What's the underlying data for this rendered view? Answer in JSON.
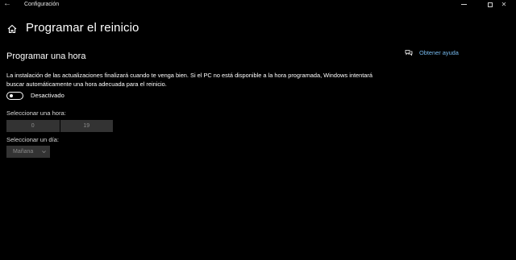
{
  "window": {
    "title": "Configuración",
    "back_glyph": "←",
    "close_glyph": "✕"
  },
  "page": {
    "title": "Programar el reinicio",
    "home_icon": "home-icon"
  },
  "section": {
    "title": "Programar una hora",
    "description": "La instalación de las actualizaciones finalizará cuando te venga bien. Si el PC no está disponible a la hora programada, Windows intentará buscar automáticamente una hora adecuada para el reinicio."
  },
  "toggle": {
    "state_label": "Desactivado",
    "on": false
  },
  "time": {
    "label": "Seleccionar una hora:",
    "hour": "0",
    "minute": "19"
  },
  "day": {
    "label": "Seleccionar un día:",
    "value": "Mañana"
  },
  "help": {
    "label": "Obtener ayuda",
    "icon": "chat-help-icon"
  },
  "colors": {
    "background": "#000000",
    "accent_link": "#76b9ed",
    "disabled_control": "#333333",
    "disabled_text": "#8a8a8a"
  }
}
